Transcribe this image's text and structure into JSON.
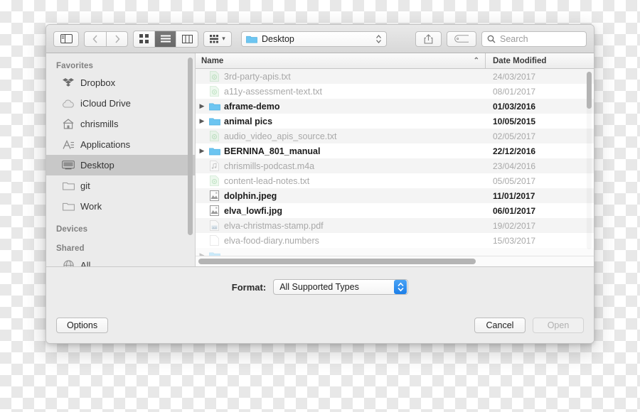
{
  "toolbar": {
    "sidebar_toggle_name": "sidebar-toggle-icon",
    "back_label": "‹",
    "forward_label": "›",
    "view_icon_grid": "icon-view-icon",
    "view_list": "list-view-icon",
    "view_columns": "column-view-icon",
    "arrange_label": "arrange-icon",
    "arrange_chevron": "⌄",
    "path_label": "Desktop",
    "share_icon": "share-icon",
    "tag_icon": "tag-icon",
    "search_placeholder": "Search"
  },
  "sidebar": {
    "sections": [
      {
        "title": "Favorites",
        "items": [
          {
            "label": "Dropbox",
            "icon": "dropbox-icon",
            "selected": false
          },
          {
            "label": "iCloud Drive",
            "icon": "icloud-icon",
            "selected": false
          },
          {
            "label": "chrismills",
            "icon": "home-icon",
            "selected": false
          },
          {
            "label": "Applications",
            "icon": "applications-icon",
            "selected": false
          },
          {
            "label": "Desktop",
            "icon": "desktop-icon",
            "selected": true
          },
          {
            "label": "git",
            "icon": "folder-icon",
            "selected": false
          },
          {
            "label": "Work",
            "icon": "folder-icon",
            "selected": false
          }
        ]
      },
      {
        "title": "Devices",
        "items": []
      },
      {
        "title": "Shared",
        "items": [
          {
            "label": "All",
            "icon": "globe-icon",
            "selected": false
          }
        ]
      }
    ]
  },
  "filelist": {
    "columns": {
      "name": "Name",
      "date": "Date Modified"
    },
    "sort_caret": "⌃",
    "rows": [
      {
        "name": "3rd-party-apis.txt",
        "date": "24/03/2017",
        "icon": "text-file-icon",
        "type": "file",
        "enabled": false,
        "expandable": false
      },
      {
        "name": "a11y-assessment-text.txt",
        "date": "08/01/2017",
        "icon": "text-file-icon",
        "type": "file",
        "enabled": false,
        "expandable": false
      },
      {
        "name": "aframe-demo",
        "date": "01/03/2016",
        "icon": "folder-icon",
        "type": "folder",
        "enabled": true,
        "expandable": true
      },
      {
        "name": "animal pics",
        "date": "10/05/2015",
        "icon": "folder-icon",
        "type": "folder",
        "enabled": true,
        "expandable": true
      },
      {
        "name": "audio_video_apis_source.txt",
        "date": "02/05/2017",
        "icon": "text-file-icon",
        "type": "file",
        "enabled": false,
        "expandable": false
      },
      {
        "name": "BERNINA_801_manual",
        "date": "22/12/2016",
        "icon": "folder-icon",
        "type": "folder",
        "enabled": true,
        "expandable": true
      },
      {
        "name": "chrismills-podcast.m4a",
        "date": "23/04/2016",
        "icon": "audio-file-icon",
        "type": "file",
        "enabled": false,
        "expandable": false
      },
      {
        "name": "content-lead-notes.txt",
        "date": "05/05/2017",
        "icon": "text-file-icon",
        "type": "file",
        "enabled": false,
        "expandable": false
      },
      {
        "name": "dolphin.jpeg",
        "date": "11/01/2017",
        "icon": "image-file-icon",
        "type": "file",
        "enabled": true,
        "expandable": false
      },
      {
        "name": "elva_lowfi.jpg",
        "date": "06/01/2017",
        "icon": "image-file-icon",
        "type": "file",
        "enabled": true,
        "expandable": false
      },
      {
        "name": "elva-christmas-stamp.pdf",
        "date": "19/02/2017",
        "icon": "pdf-file-icon",
        "type": "file",
        "enabled": false,
        "expandable": false
      },
      {
        "name": "elva-food-diary.numbers",
        "date": "15/03/2017",
        "icon": "numbers-file-icon",
        "type": "file",
        "enabled": false,
        "expandable": false
      }
    ]
  },
  "format": {
    "label": "Format:",
    "value": "All Supported Types",
    "accent_color": "#1d7fe8"
  },
  "buttons": {
    "options": "Options",
    "cancel": "Cancel",
    "open": "Open"
  }
}
